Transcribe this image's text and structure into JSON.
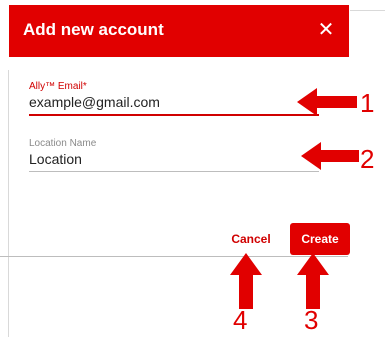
{
  "dialog": {
    "title": "Add new account",
    "close_glyph": "✕",
    "close_icon": "close-icon"
  },
  "fields": {
    "email": {
      "label": "Ally™ Email*",
      "value": "example@gmail.com"
    },
    "location": {
      "label": "Location Name",
      "value": "Location"
    }
  },
  "actions": {
    "cancel_label": "Cancel",
    "create_label": "Create"
  },
  "annotations": {
    "email_number": "1",
    "location_number": "2",
    "create_number": "3",
    "cancel_number": "4"
  },
  "colors": {
    "brand_red": "#e10000",
    "label_red": "#d00000",
    "annotation_red": "#e10000"
  }
}
